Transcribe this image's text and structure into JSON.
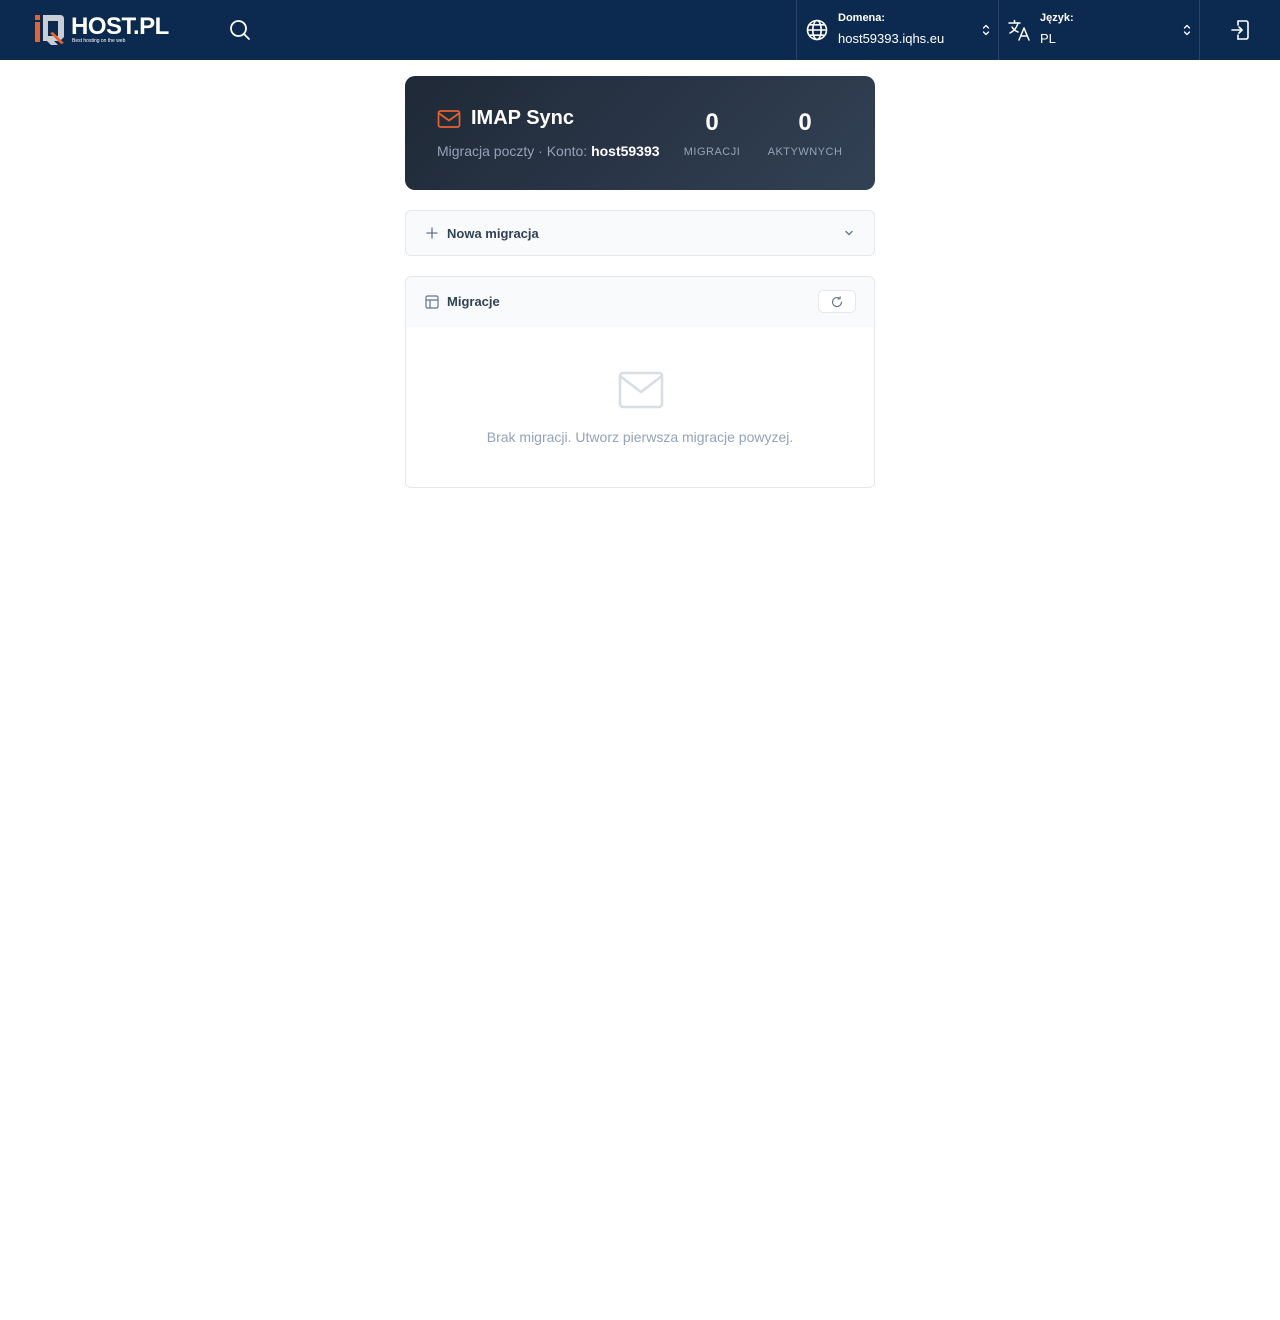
{
  "header": {
    "logo_text": "HOST.PL",
    "logo_tagline": "Best hosting on the web",
    "search_icon": "search-icon",
    "domain": {
      "label": "Domena:",
      "value": "host59393.iqhs.eu",
      "icon": "globe-icon"
    },
    "language": {
      "label": "Język:",
      "value": "PL",
      "icon": "translate-icon"
    },
    "logout_icon": "logout-icon",
    "background_color": "#0c2a4f",
    "accent_color": "#e8622c"
  },
  "hero": {
    "title": "IMAP Sync",
    "subtitle_prefix": "Migracja poczty · Konto: ",
    "account": "host59393",
    "stats": [
      {
        "value": "0",
        "label": "MIGRACJI"
      },
      {
        "value": "0",
        "label": "AKTYWNYCH"
      }
    ]
  },
  "new_migration": {
    "label": "Nowa migracja"
  },
  "migrations": {
    "title": "Migracje",
    "empty_message": "Brak migracji. Utworz pierwsza migracje powyzej."
  }
}
